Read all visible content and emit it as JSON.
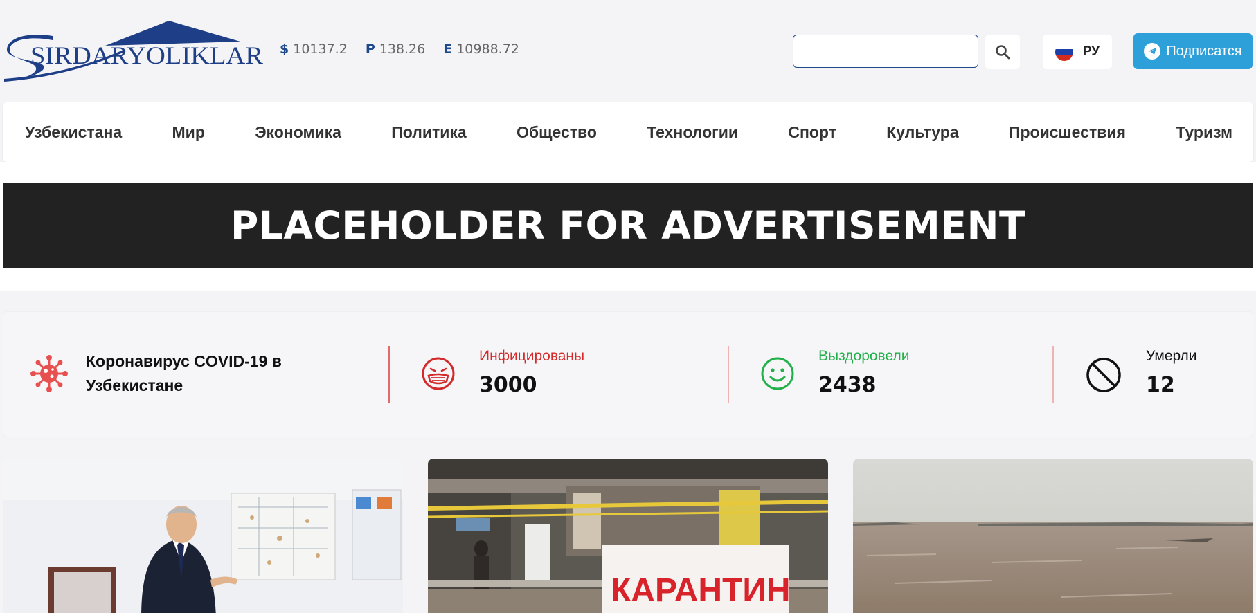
{
  "header": {
    "logo_text": "SIRDARYOLIKLAR",
    "rates": [
      {
        "symbol": "$",
        "value": "10137.2"
      },
      {
        "symbol": "Р",
        "value": "138.26"
      },
      {
        "symbol": "Е",
        "value": "10988.72"
      }
    ],
    "search": {
      "placeholder": "",
      "value": ""
    },
    "lang_label": "РУ",
    "subscribe_label": "Подписатся"
  },
  "nav": {
    "items": [
      "Узбекистана",
      "Мир",
      "Экономика",
      "Политика",
      "Общество",
      "Технологии",
      "Спорт",
      "Культура",
      "Происшествия",
      "Туризм"
    ]
  },
  "ad": {
    "text": "PLACEHOLDER FOR ADVERTISEMENT"
  },
  "covid": {
    "title": "Коронавирус COVID-19 в Узбекистане",
    "infected": {
      "label": "Инфицированы",
      "value": "3000",
      "color": "#d42a2a"
    },
    "recovered": {
      "label": "Выздоровели",
      "value": "2438",
      "color": "#22b04a"
    },
    "deaths": {
      "label": "Умерли",
      "value": "12",
      "color": "#111111"
    }
  },
  "cards": [
    {
      "image": "president-at-map-board-photo"
    },
    {
      "image": "quarantine-sign-market-photo",
      "sign_text": "КАРАНТИН"
    },
    {
      "image": "flooded-river-photo"
    }
  ],
  "colors": {
    "brand_blue": "#1e4a8c",
    "telegram": "#2d9fd9",
    "ad_bg": "#222222"
  }
}
